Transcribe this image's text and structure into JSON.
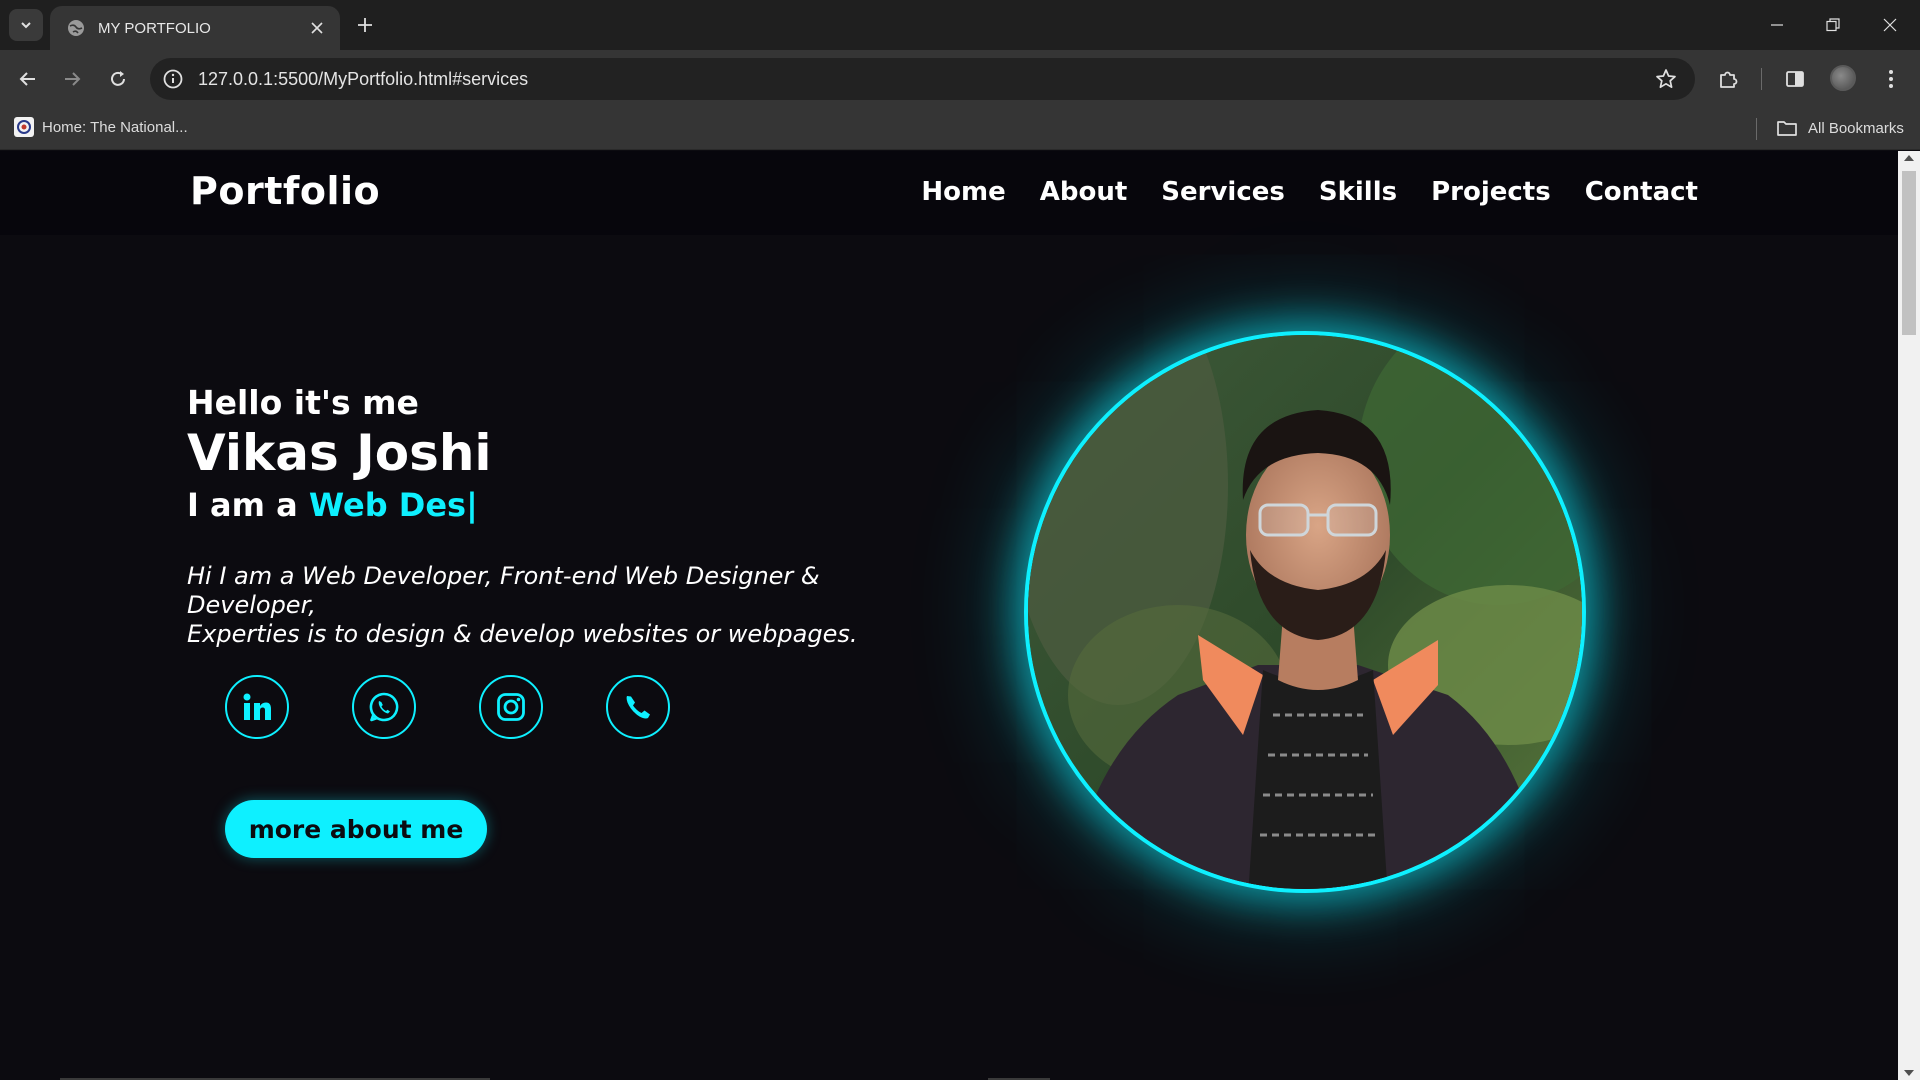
{
  "browser": {
    "tab_title": "MY PORTFOLIO",
    "url": "127.0.0.1:5500/MyPortfolio.html#services",
    "bookmark_label": "Home: The National...",
    "all_bookmarks_label": "All Bookmarks"
  },
  "site": {
    "logo": "Portfolio",
    "nav": [
      "Home",
      "About",
      "Services",
      "Skills",
      "Projects",
      "Contact"
    ]
  },
  "hero": {
    "greeting": "Hello it's me",
    "name": "Vikas Joshi",
    "role_prefix": "I am a",
    "role_typed": "Web Des",
    "cursor": "|",
    "intro_line1": "Hi I am a Web Developer, Front-end Web Designer & Developer,",
    "intro_line2": "Experties is to design & develop websites or webpages.",
    "cta_label": "more about me"
  },
  "socials": [
    "linkedin-icon",
    "whatsapp-icon",
    "instagram-icon",
    "phone-icon"
  ],
  "colors": {
    "accent": "#0ef0ff",
    "background": "#0c0b10",
    "header": "#07060c"
  }
}
